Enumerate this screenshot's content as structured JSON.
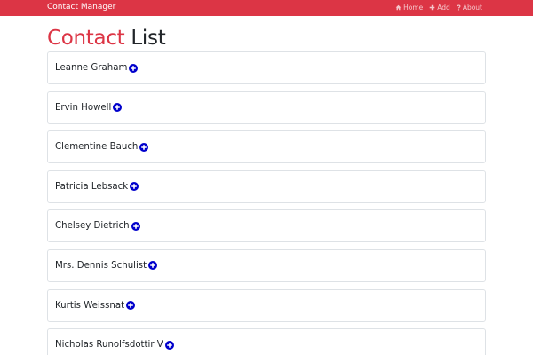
{
  "navbar": {
    "brand": "Contact Manager",
    "links": [
      {
        "label": "Home",
        "icon": "home-icon"
      },
      {
        "label": "Add",
        "icon": "plus-icon"
      },
      {
        "label": "About",
        "icon": "question-icon"
      }
    ]
  },
  "page": {
    "title_accent": "Contact",
    "title_rest": "List"
  },
  "contacts": [
    {
      "name": "Leanne Graham"
    },
    {
      "name": "Ervin Howell"
    },
    {
      "name": "Clementine Bauch"
    },
    {
      "name": "Patricia Lebsack"
    },
    {
      "name": "Chelsey Dietrich"
    },
    {
      "name": "Mrs. Dennis Schulist"
    },
    {
      "name": "Kurtis Weissnat"
    },
    {
      "name": "Nicholas Runolfsdottir V"
    }
  ],
  "colors": {
    "navbar": "#dc3545",
    "accent": "#dc3545",
    "add_icon": "#0000cc"
  }
}
